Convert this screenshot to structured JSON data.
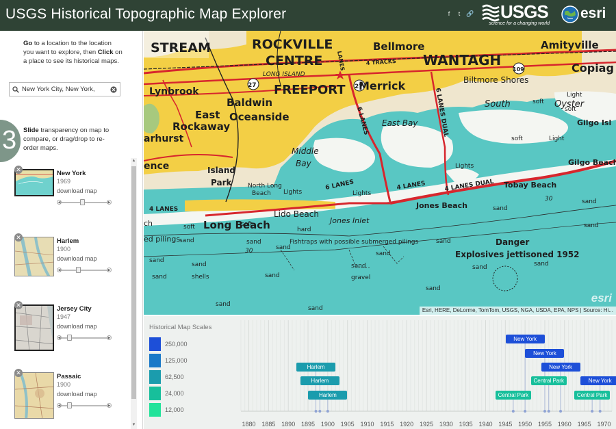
{
  "header": {
    "title": "USGS Historical Topographic Map Explorer",
    "social_icons": [
      "facebook-icon",
      "twitter-icon",
      "link-icon"
    ],
    "usgs_wordmark": "USGS",
    "usgs_tagline": "science for a changing world",
    "esri_wordmark": "esri"
  },
  "sidebar": {
    "step2": {
      "bold1": "Go",
      "text1": " to a location to the location you want to explore, then ",
      "bold2": "Click",
      "text2": " on a place to see its historical maps."
    },
    "search": {
      "value": "New York City, New York,",
      "icon": "search-icon",
      "clear_icon": "clear-icon"
    },
    "step3": {
      "number": "3",
      "bold": "Slide",
      "text": " transparency on map to compare, or drag/drop to re-order maps."
    },
    "maps": [
      {
        "name": "New York",
        "year": "1969",
        "download": "download map",
        "opacity": 0.5
      },
      {
        "name": "Harlem",
        "year": "1900",
        "download": "download map",
        "opacity": 0.4
      },
      {
        "name": "Jersey City",
        "year": "1947",
        "download": "download map",
        "opacity": 0.2
      },
      {
        "name": "Passaic",
        "year": "1900",
        "download": "download map",
        "opacity": 0.2
      }
    ]
  },
  "map": {
    "labels": {
      "stream": "STREAM",
      "rockville": "ROCKVILLE",
      "centre": "CENTRE",
      "bellmore": "Bellmore",
      "amityville": "Amityville",
      "long_island": "LONG ISLAND",
      "wantagh": "WANTAGH",
      "copiag": "Copiag",
      "lynbrook": "Lynbrook",
      "freeport": "FREEPORT",
      "merrick": "Merrick",
      "biltmore": "Biltmore Shores",
      "baldwin": "Baldwin",
      "east": "East",
      "oceanside": "Oceanside",
      "rockaway": "Rockaway",
      "south": "South",
      "oyster": "Oyster",
      "east_bay": "East Bay",
      "middle": "Middle",
      "bay": "Bay",
      "gilgo_island": "Gilgo Isl",
      "gilgo_beach": "Gilgo Beach",
      "harhurst": "arhurst",
      "ence": "ence",
      "island": "Island",
      "park": "Park",
      "north_long": "North Long",
      "beach": "Beach",
      "tobay": "Tobay Beach",
      "jones_beach": "Jones Beach",
      "lido": "Lido Beach",
      "jones_inlet": "Jones Inlet",
      "long_beach": "Long Beach",
      "fishtraps": "Fishtraps with possible submerged pilings",
      "danger": "Danger",
      "explosives": "Explosives jettisoned 1952",
      "four_lanes": "4 LANES",
      "four_lanes_dual": "4 LANES DUAL",
      "six_lanes": "6 LANES",
      "six_lanes_dual": "6 LANES DUAL",
      "four_tracks": "4 TRACKS",
      "lanes": "LANES",
      "road_27": "27",
      "road_27a": "27",
      "road_109": "109",
      "lights": "Lights",
      "light": "Light",
      "soft": "soft",
      "sand": "sand",
      "hard": "hard",
      "shells": "shells",
      "gravel": "gravel",
      "ch": "ch",
      "ed_pilings": "ed pilings",
      "depth_30": "30",
      "depth_30b": "30"
    },
    "attribution": "Esri, HERE, DeLorme, TomTom, USGS, NGA, USDA, EPA, NPS | Source: Hi...",
    "watermark": "esri"
  },
  "timeline": {
    "title": "Historical Map Scales",
    "scales": [
      {
        "label": "250,000",
        "color": "#1d4fd8"
      },
      {
        "label": "125,000",
        "color": "#1a79c8"
      },
      {
        "label": "62,500",
        "color": "#1b9cad"
      },
      {
        "label": "24,000",
        "color": "#17bf9b"
      },
      {
        "label": "12,000",
        "color": "#22e39a"
      }
    ],
    "year_start": 1878,
    "year_end": 1972,
    "ticks": [
      "1880",
      "1885",
      "1890",
      "1895",
      "1900",
      "1905",
      "1910",
      "1915",
      "1920",
      "1925",
      "1930",
      "1935",
      "1940",
      "1945",
      "1950",
      "1955",
      "1960",
      "1965",
      "1970"
    ],
    "items": [
      {
        "label": "Harlem",
        "year": 1897,
        "row": 2,
        "color": "#1b9cad"
      },
      {
        "label": "Harlem",
        "year": 1898,
        "row": 3,
        "color": "#1b9cad"
      },
      {
        "label": "Harlem",
        "year": 1900,
        "row": 4,
        "color": "#1b9cad"
      },
      {
        "label": "New York",
        "year": 1950,
        "row": 0,
        "color": "#1d4fd8"
      },
      {
        "label": "New York",
        "year": 1955,
        "row": 1,
        "color": "#1d4fd8"
      },
      {
        "label": "New York",
        "year": 1959,
        "row": 2,
        "color": "#1d4fd8"
      },
      {
        "label": "New York",
        "year": 1969,
        "row": 3,
        "color": "#1d4fd8"
      },
      {
        "label": "Central Park",
        "year": 1956,
        "row": 3,
        "color": "#17bf9b"
      },
      {
        "label": "Central Park",
        "year": 1947,
        "row": 4,
        "color": "#17bf9b"
      },
      {
        "label": "Central Park",
        "year": 1967,
        "row": 4,
        "color": "#17bf9b"
      }
    ]
  }
}
